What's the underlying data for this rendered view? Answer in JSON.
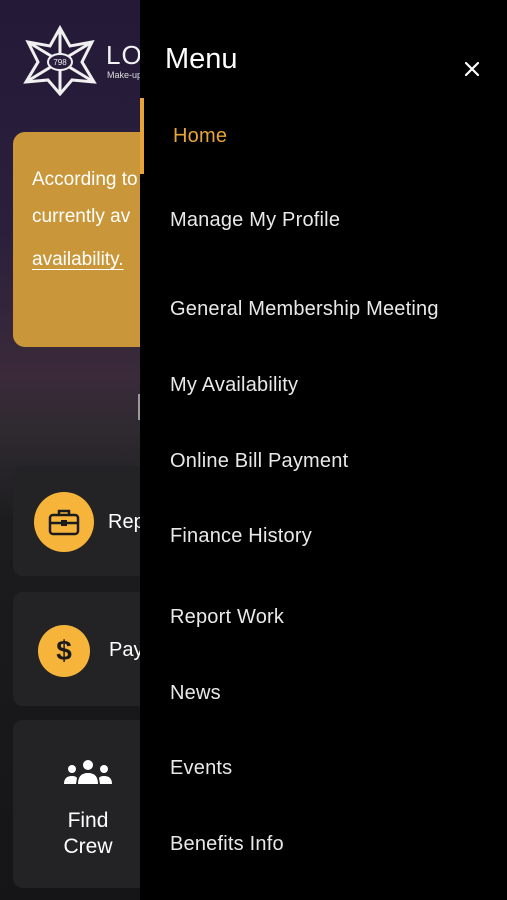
{
  "background": {
    "logo": {
      "badge_number": "798",
      "title": "LOC",
      "subtitle": "Make-up"
    },
    "banner": {
      "line1": "According to",
      "line2": "currently av",
      "link": "availability."
    },
    "cards": [
      {
        "label": "Rep",
        "icon": "briefcase-icon"
      },
      {
        "label": "Pay",
        "icon": "dollar-icon"
      },
      {
        "label": "Find Crew",
        "icon": "group-icon"
      }
    ],
    "colors": {
      "banner": "#c9973a",
      "accent_circle": "#f6b53a",
      "card": "#232325"
    }
  },
  "drawer": {
    "title": "Menu",
    "close_icon": "close-icon",
    "accent_color": "#e8a33a",
    "active_index": 0,
    "items": [
      {
        "label": "Home"
      },
      {
        "label": "Manage My Profile"
      },
      {
        "label": "General Membership Meeting"
      },
      {
        "label": "My Availability"
      },
      {
        "label": "Online Bill Payment"
      },
      {
        "label": "Finance History"
      },
      {
        "label": "Report Work"
      },
      {
        "label": "News"
      },
      {
        "label": "Events"
      },
      {
        "label": "Benefits Info"
      }
    ]
  }
}
